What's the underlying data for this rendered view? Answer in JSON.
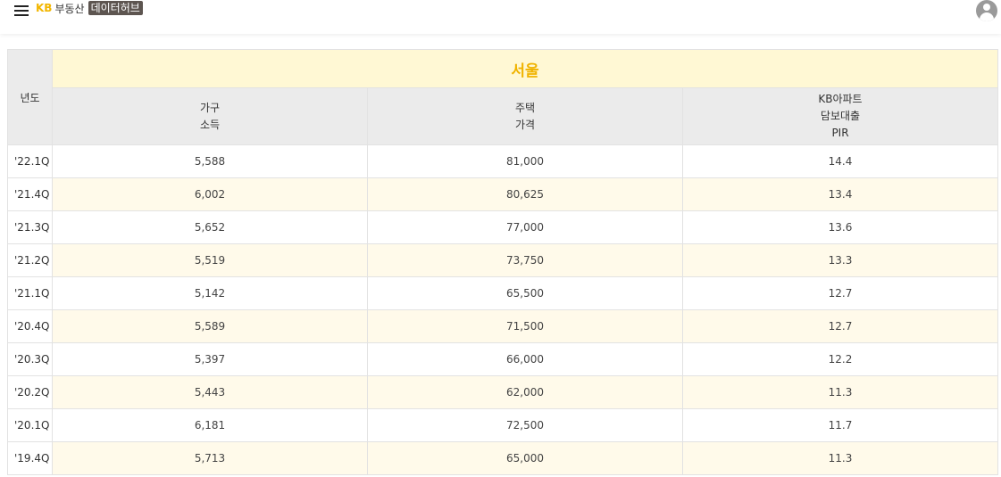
{
  "header": {
    "logo_kb": "KB",
    "logo_name": "부동산",
    "logo_badge": "데이터허브"
  },
  "table": {
    "year_header": "년도",
    "region": "서울",
    "columns": [
      [
        "가구",
        "소득"
      ],
      [
        "주택",
        "가격"
      ],
      [
        "KB아파트",
        "담보대출",
        "PIR"
      ]
    ],
    "rows": [
      [
        "'22.1Q",
        "5,588",
        "81,000",
        "14.4"
      ],
      [
        "'21.4Q",
        "6,002",
        "80,625",
        "13.4"
      ],
      [
        "'21.3Q",
        "5,652",
        "77,000",
        "13.6"
      ],
      [
        "'21.2Q",
        "5,519",
        "73,750",
        "13.3"
      ],
      [
        "'21.1Q",
        "5,142",
        "65,500",
        "12.7"
      ],
      [
        "'20.4Q",
        "5,589",
        "71,500",
        "12.7"
      ],
      [
        "'20.3Q",
        "5,397",
        "66,000",
        "12.2"
      ],
      [
        "'20.2Q",
        "5,443",
        "62,000",
        "11.3"
      ],
      [
        "'20.1Q",
        "6,181",
        "72,500",
        "11.7"
      ],
      [
        "'19.4Q",
        "5,713",
        "65,000",
        "11.3"
      ]
    ]
  },
  "colors": {
    "brand": "#f2b600",
    "region_bg": "#fff8d4",
    "header_bg": "#ebebeb",
    "alt_row_bg": "#fffaea"
  }
}
